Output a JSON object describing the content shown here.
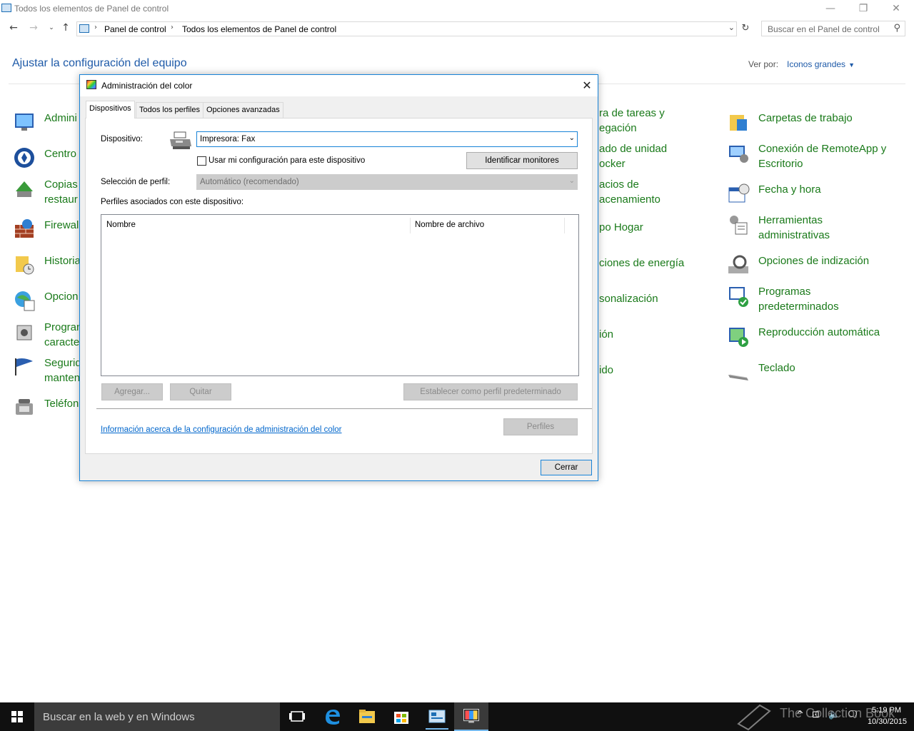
{
  "window": {
    "title": "Todos los elementos de Panel de control"
  },
  "nav": {
    "breadcrumb": [
      "Panel de control",
      "Todos los elementos de Panel de control"
    ],
    "search_placeholder": "Buscar en el Panel de control"
  },
  "controlpanel": {
    "heading": "Ajustar la configuración del equipo",
    "view_by_label": "Ver por:",
    "view_by_value": "Iconos grandes",
    "left_items": [
      {
        "label": "Admini",
        "icon": "admin-icon"
      },
      {
        "label": "Centro",
        "icon": "sync-center-icon"
      },
      {
        "label": "Copias ...\nrestaur",
        "icon": "backup-icon"
      },
      {
        "label": "Firewal",
        "icon": "firewall-icon"
      },
      {
        "label": "Historia",
        "icon": "file-history-icon"
      },
      {
        "label": "Opcion",
        "icon": "internet-options-icon"
      },
      {
        "label": "Progran\ncaracte",
        "icon": "programs-features-icon"
      },
      {
        "label": "Segurid\nmanten",
        "icon": "security-maintenance-icon"
      },
      {
        "label": "Teléfon",
        "icon": "phone-modem-icon"
      }
    ],
    "middle_items": [
      "ra de tareas y\negación",
      "ado de unidad\nocker",
      "acios de\nacenamiento",
      "po Hogar",
      "ciones de energía",
      "sonalización",
      "ión",
      "ido"
    ],
    "right_items": [
      {
        "label": "Carpetas de trabajo",
        "icon": "work-folders-icon"
      },
      {
        "label": "Conexión de RemoteApp y\nEscritorio",
        "icon": "remoteapp-icon"
      },
      {
        "label": "Fecha y hora",
        "icon": "date-time-icon"
      },
      {
        "label": "Herramientas\nadministrativas",
        "icon": "admin-tools-icon"
      },
      {
        "label": "Opciones de indización",
        "icon": "indexing-icon"
      },
      {
        "label": "Programas\npredeterminados",
        "icon": "default-programs-icon"
      },
      {
        "label": "Reproducción automática",
        "icon": "autoplay-icon"
      },
      {
        "label": "Teclado",
        "icon": "keyboard-icon"
      }
    ]
  },
  "dialog": {
    "title": "Administración del color",
    "tabs": [
      "Dispositivos",
      "Todos los perfiles",
      "Opciones avanzadas"
    ],
    "device_label": "Dispositivo:",
    "device_value": "Impresora: Fax",
    "use_settings_label": "Usar mi configuración para este dispositivo",
    "identify_button": "Identificar monitores",
    "profile_selection_label": "Selección de perfil:",
    "profile_selection_value": "Automático (recomendado)",
    "associated_label": "Perfiles asociados con este dispositivo:",
    "columns": [
      "Nombre",
      "Nombre de archivo"
    ],
    "add_button": "Agregar...",
    "remove_button": "Quitar",
    "set_default_button": "Establecer como perfil predeterminado",
    "info_link": "Información acerca de la configuración de administración del color",
    "profiles_button": "Perfiles",
    "close_button": "Cerrar"
  },
  "taskbar": {
    "search_placeholder": "Buscar en la web y en Windows",
    "watermark": "The Collection Book",
    "time": "5:19 PM",
    "date": "10/30/2015"
  }
}
